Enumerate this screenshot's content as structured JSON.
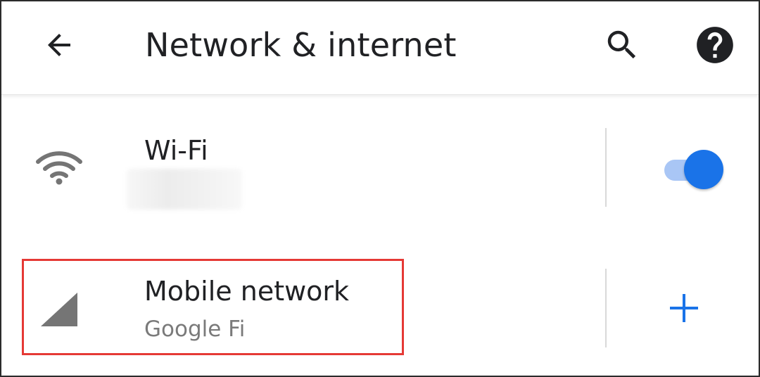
{
  "header": {
    "title": "Network & internet",
    "back_icon": "arrow-back-icon",
    "search_icon": "search-icon",
    "help_icon": "help-icon"
  },
  "rows": {
    "wifi": {
      "title": "Wi-Fi",
      "icon": "wifi-icon",
      "toggle_on": true
    },
    "mobile": {
      "title": "Mobile network",
      "summary": "Google Fi",
      "icon": "signal-icon",
      "action_icon": "add-icon"
    }
  },
  "colors": {
    "accent": "#1a73e8",
    "toggle_track": "#a9c6f5",
    "highlight": "#e53935",
    "text_primary": "#202124",
    "text_secondary": "#7a7a7a",
    "icon_gray": "#757575"
  }
}
